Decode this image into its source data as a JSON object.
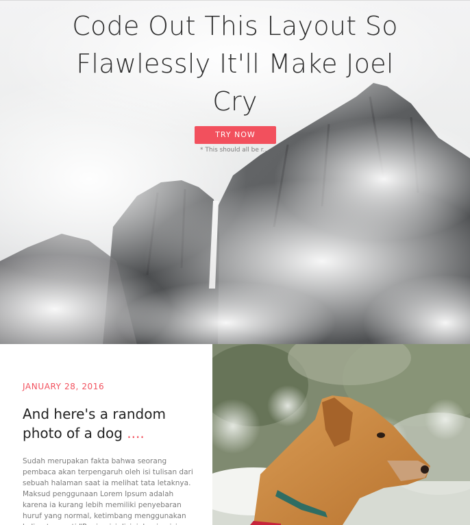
{
  "hero": {
    "title": "Code Out This Layout So Flawlessly It'll Make Joel Cry",
    "cta_label": "TRY NOW",
    "note": "* This should all be r..."
  },
  "article": {
    "date": "JANUARY 28, 2016",
    "title": "And here's a random photo of a dog",
    "title_suffix": " ....",
    "body": "Sudah merupakan fakta bahwa seorang pembaca akan terpengaruh oleh isi tulisan dari sebuah halaman saat ia melihat tata letaknya. Maksud penggunaan Lorem Ipsum adalah karena ia kurang lebih memiliki penyebaran huruf yang normal, ketimbang menggunakan kalimat seperti \"Bagian isi disini, bagian isi disini\", sehingga ia"
  },
  "colors": {
    "accent": "#f2505d",
    "heading": "#2d2d2d",
    "body_text": "#7b7b7b"
  },
  "images": {
    "hero": "mountain-waterfall-fog-photo",
    "dog": "golden-dog-profile-photo"
  }
}
